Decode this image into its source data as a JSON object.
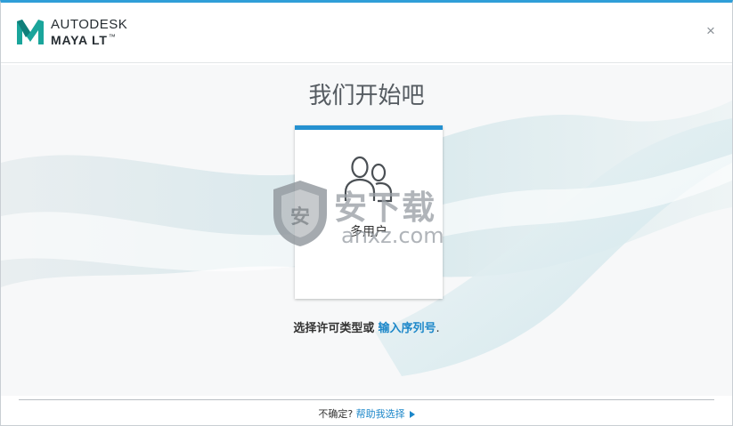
{
  "header": {
    "company": "AUTODESK",
    "product": "MAYA LT",
    "product_tm": "™",
    "close_glyph": "×"
  },
  "main": {
    "title": "我们开始吧",
    "license_card": {
      "label": "多用户",
      "icon": "users-icon",
      "accent_color": "#2591d0"
    },
    "choose_prefix": "选择许可类型或",
    "serial_link": "输入序列号",
    "choose_suffix": "."
  },
  "footer": {
    "unsure_text": "不确定?",
    "help_link": "帮助我选择"
  },
  "watermark": {
    "cn_text": "安下载",
    "en_text": "anxz.com",
    "shield_glyph": "安"
  },
  "colors": {
    "accent": "#2f9ed8",
    "link": "#1c87c9"
  }
}
